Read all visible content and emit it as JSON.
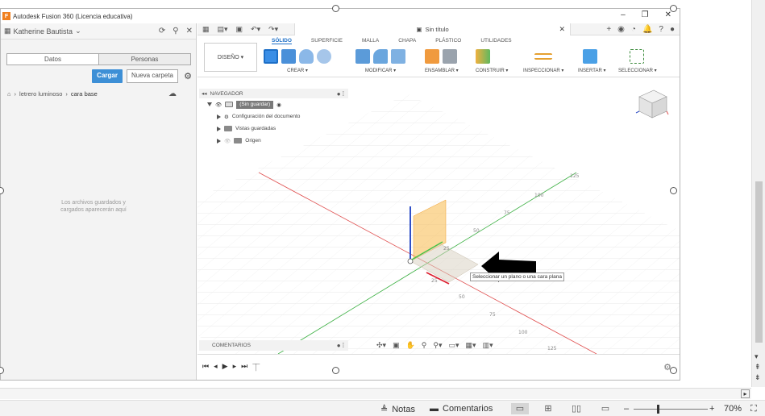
{
  "fusion_window": {
    "title": "Autodesk Fusion 360 (Licencia educativa)",
    "app_icon_letter": "F",
    "window_buttons": [
      "–",
      "❐",
      "✕"
    ]
  },
  "data_panel": {
    "user_name": "Katherine Bautista",
    "tabs": [
      {
        "label": "Datos",
        "active": true
      },
      {
        "label": "Personas",
        "active": false
      }
    ],
    "upload_button": "Cargar",
    "new_folder_button": "Nueva carpeta",
    "breadcrumb": [
      "letrero luminoso",
      "cara base"
    ],
    "empty_text_line1": "Los archivos guardados y",
    "empty_text_line2": "cargados aparecerán aquí"
  },
  "document": {
    "tab_title": "Sin título",
    "workspace": "DISEÑO ▾"
  },
  "ribbon": {
    "tabs": [
      {
        "label": "SÓLIDO",
        "active": true
      },
      {
        "label": "SUPERFICIE",
        "active": false
      },
      {
        "label": "MALLA",
        "active": false
      },
      {
        "label": "CHAPA",
        "active": false
      },
      {
        "label": "PLÁSTICO",
        "active": false
      },
      {
        "label": "UTILIDADES",
        "active": false
      }
    ],
    "groups": [
      "CREAR ▾",
      "MODIFICAR ▾",
      "ENSAMBLAR ▾",
      "CONSTRUIR ▾",
      "INSPECCIONAR ▾",
      "INSERTAR ▾",
      "SELECCIONAR ▾"
    ],
    "accent_color": "#1d6fc7"
  },
  "navigator": {
    "header": "NAVEGADOR",
    "root": "(Sin guardar)",
    "items": [
      "Configuración del documento",
      "Vistas guardadas",
      "Origen"
    ]
  },
  "viewport": {
    "axis_ticks_green": [
      "125",
      "100",
      "75",
      "50",
      "25"
    ],
    "axis_ticks_red": [
      "25",
      "50",
      "75",
      "100",
      "125"
    ],
    "tooltip": "Seleccionar un plano o una cara plana",
    "x_axis_color": "#e05050",
    "y_axis_color": "#3cb043",
    "z_axis_color": "#3050c8",
    "plane_color": "#f7b94a"
  },
  "comments_label": "COMENTARIOS",
  "statusbar": {
    "notes": "Notas",
    "comments": "Comentarios",
    "zoom": "70%"
  }
}
